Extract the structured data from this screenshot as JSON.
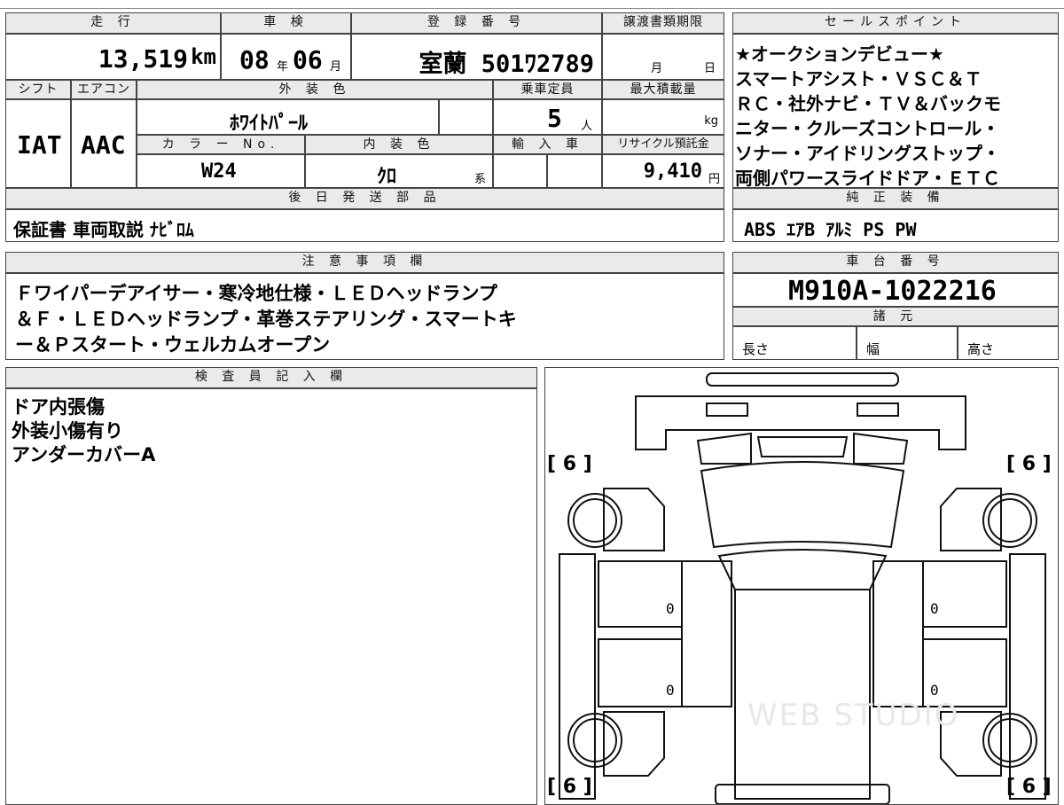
{
  "mileage": {
    "header": "走 行",
    "value": "13,519",
    "unit": "km"
  },
  "inspection": {
    "header": "車 検",
    "year": "08",
    "year_unit": "年",
    "month": "06",
    "month_unit": "月"
  },
  "registration": {
    "header": "登 録 番 号",
    "value": "室蘭 501ﾜ2789"
  },
  "transfer_deadline": {
    "header": "譲渡書類期限",
    "month_unit": "月",
    "day_unit": "日"
  },
  "shift": {
    "header": "シフト",
    "value": "IAT"
  },
  "aircon": {
    "header": "エアコン",
    "value": "AAC"
  },
  "exterior_color": {
    "header": "外 装 色",
    "value": "ﾎﾜｲﾄﾊﾟｰﾙ"
  },
  "capacity": {
    "header": "乗車定員",
    "value": "5",
    "unit": "人"
  },
  "max_load": {
    "header": "最大積載量",
    "unit": "kg"
  },
  "color_no": {
    "header": "カ ラ ー No.",
    "value": "W24"
  },
  "interior_color": {
    "header": "内 装 色",
    "value": "ｸﾛ",
    "unit": "系"
  },
  "import": {
    "header": "輸 入 車"
  },
  "recycle": {
    "header": "リサイクル預託金",
    "value": "9,410",
    "unit": "円"
  },
  "later_parts": {
    "header": "後 日 発 送 部 品",
    "value": "保証書 車両取説 ﾅﾋﾞﾛﾑ"
  },
  "sales_points": {
    "header": "セールスポイント",
    "lines": [
      "★オークションデビュー★",
      "スマートアシスト・ＶＳＣ＆Ｔ",
      "ＲＣ・社外ナビ・ＴＶ＆バックモ",
      "ニター・クルーズコントロール・",
      "ソナー・アイドリングストップ・",
      "両側パワースライドドア・ＥＴＣ"
    ]
  },
  "genuine_equipment": {
    "header": "純 正 装 備",
    "value": "ABS ｴｱB ｱﾙﾐ PS PW"
  },
  "notes": {
    "header": "注 意 事 項 欄",
    "lines": [
      "Ｆワイパーデアイサー・寒冷地仕様・ＬＥＤヘッドランプ",
      "＆Ｆ・ＬＥＤヘッドランプ・革巻ステアリング・スマートキ",
      "ー＆Ｐスタート・ウェルカムオープン"
    ]
  },
  "chassis": {
    "header": "車 台 番 号",
    "value": "M910A-1022216"
  },
  "specs": {
    "header": "諸 元",
    "length": "長さ",
    "width": "幅",
    "height": "高さ"
  },
  "inspector": {
    "header": "検 査 員 記 入 欄",
    "lines": [
      "ドア内張傷",
      "外装小傷有り",
      "アンダーカバーA"
    ]
  },
  "diagram": {
    "tire_fl": "[ 6 ]",
    "tire_fr": "[ 6 ]",
    "tire_rl": "[ 6 ]",
    "tire_rr": "[ 6 ]",
    "door_fl": "0",
    "door_fr": "0",
    "door_rl": "0",
    "door_rr": "0",
    "watermark": "WEB STUDIO"
  }
}
